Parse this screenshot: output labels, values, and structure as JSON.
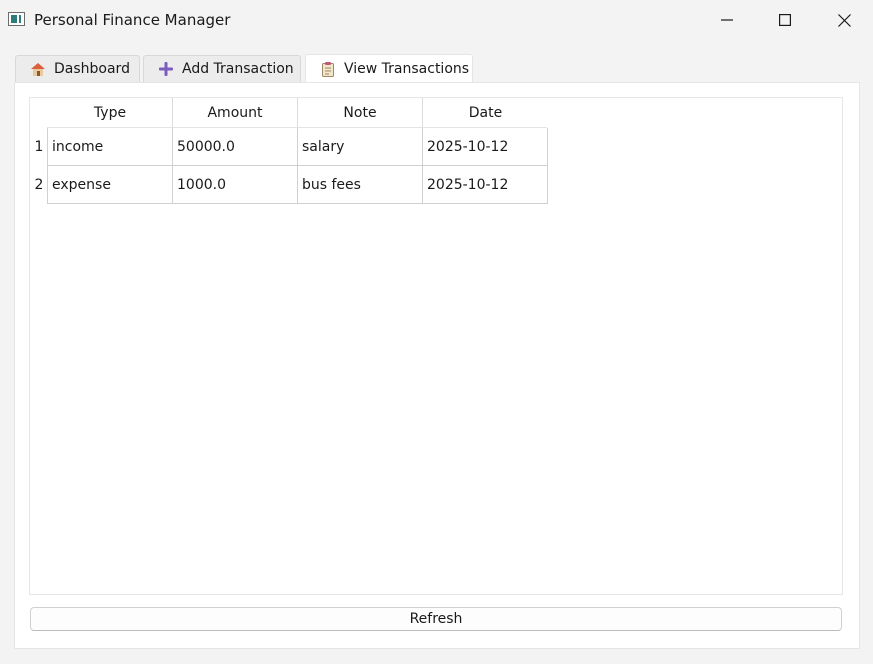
{
  "window": {
    "title": "Personal Finance Manager"
  },
  "tabs": [
    {
      "label": "Dashboard",
      "icon": "house-icon"
    },
    {
      "label": "Add Transaction",
      "icon": "plus-icon"
    },
    {
      "label": "View Transactions",
      "icon": "clipboard-icon",
      "active": true
    }
  ],
  "table": {
    "columns": [
      "Type",
      "Amount",
      "Note",
      "Date"
    ],
    "rows": [
      {
        "num": "1",
        "type": "income",
        "amount": "50000.0",
        "note": "salary",
        "date": "2025-10-12"
      },
      {
        "num": "2",
        "type": "expense",
        "amount": "1000.0",
        "note": "bus fees",
        "date": "2025-10-12"
      }
    ]
  },
  "actions": {
    "refresh_label": "Refresh"
  },
  "colors": {
    "plus_icon": "#7b5cbf",
    "app_icon_accent": "#2e7d7d"
  }
}
